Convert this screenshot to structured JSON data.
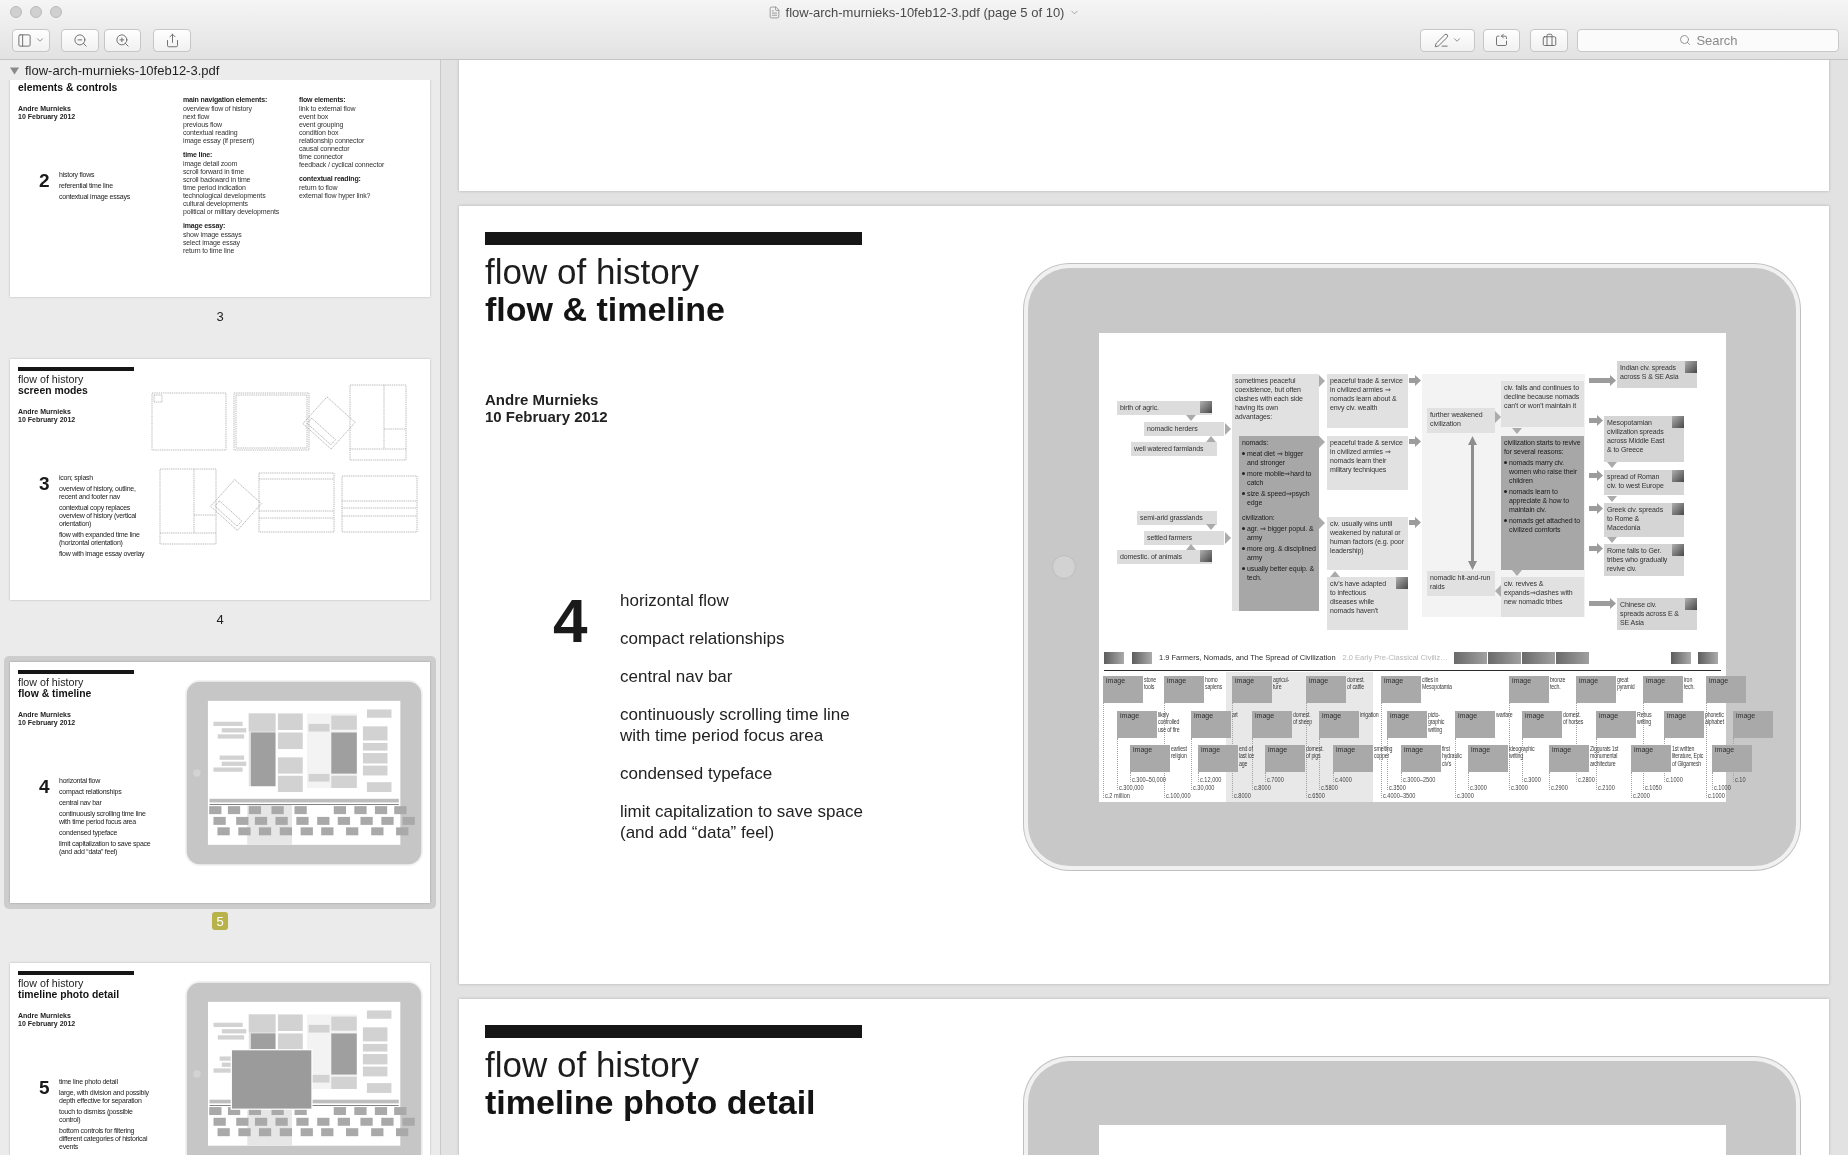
{
  "window": {
    "title": "flow-arch-murnieks-10feb12-3.pdf (page 5 of 10)"
  },
  "toolbar": {
    "search": {
      "placeholder": "Search"
    }
  },
  "sidebar": {
    "file": {
      "name": "flow-arch-murnieks-10feb12-3.pdf",
      "expanded": true
    },
    "thumbnails": [
      {
        "kind": "columns",
        "subtitle": "elements & controls",
        "author": "Andre Murnieks",
        "date": "10 February 2012",
        "number": "2",
        "points": [
          "history flows",
          "referential time line",
          "contextual image essays"
        ],
        "columns": [
          [
            {
              "heading": "main navigation elements:",
              "items": [
                "overview flow of history",
                "next flow",
                "previous flow",
                "contextual reading",
                "image essay (if present)"
              ]
            },
            {
              "heading": "time line:",
              "items": [
                "image detail zoom",
                "scroll forward in time",
                "scroll backward in time",
                "time period indication",
                "technological developments",
                "cultural developments",
                "political or military developments"
              ]
            },
            {
              "heading": "image essay:",
              "items": [
                "show image essays",
                "select image essay",
                "return to time line"
              ]
            }
          ],
          [
            {
              "heading": "flow elements:",
              "items": [
                "link to external flow",
                "event box",
                "event grouping",
                "condition box",
                "relationship connector",
                "causal connector",
                "time connector",
                "feedback / cyclical connector"
              ]
            },
            {
              "heading": "contextual reading:",
              "items": [
                "return to flow",
                "external flow hyper link?"
              ]
            }
          ]
        ],
        "page_label": "3",
        "selected": false
      },
      {
        "kind": "wireframes",
        "title": "flow of history",
        "subtitle": "screen modes",
        "author": "Andre Murnieks",
        "date": "10 February 2012",
        "number": "3",
        "points": [
          "icon; splash",
          "overview of history, outline,\nrecent and footer nav",
          "contextual copy replaces\noverview of history (vertical\norientation)",
          "flow with expanded time line\n(horizontal orientation)",
          "flow with image essay overlay"
        ],
        "page_label": "4",
        "selected": false
      },
      {
        "kind": "tablet",
        "title": "flow of history",
        "subtitle": "flow & timeline",
        "author": "Andre Murnieks",
        "date": "10 February 2012",
        "number": "4",
        "points": [
          "horizontal flow",
          "compact relationships",
          "central nav bar",
          "continuously scrolling time line\nwith time period focus area",
          "condensed typeface",
          "limit capitalization to save space\n(and add “data” feel)"
        ],
        "page_label": "5",
        "selected": true
      },
      {
        "kind": "tablet-photo",
        "title": "flow of history",
        "subtitle": "timeline photo detail",
        "author": "Andre Murnieks",
        "date": "10 February 2012",
        "number": "5",
        "points": [
          "time line photo detail",
          "large, with division and possibly\ndepth effective for separation",
          "touch to dismiss (possible\ncontrol)",
          "bottom controls for filtering\ndifferent categories of historical\nevents"
        ],
        "selected": false
      }
    ]
  },
  "pages": [
    {
      "kind": "blank"
    },
    {
      "kind": "slide",
      "title": "flow of history",
      "subtitle": "flow & timeline",
      "author": "Andre Murnieks",
      "date": "10 February 2012",
      "number": "4",
      "points": [
        "horizontal flow",
        "compact relationships",
        "central nav bar",
        "continuously scrolling time line\nwith time period focus area",
        "condensed typeface",
        "limit capitalization to save space\n(and add “data” feel)"
      ],
      "tablet": {
        "flow": {
          "nodes": [
            {
              "kind": "condition",
              "text": "birth of agric.",
              "thumbnail": true
            },
            {
              "kind": "condition",
              "text": "nomadic herders",
              "thumbnail": false
            },
            {
              "kind": "condition",
              "text": "well watered farmlands",
              "thumbnail": false
            },
            {
              "kind": "condition",
              "text": "semi-arid grasslands",
              "thumbnail": false
            },
            {
              "kind": "condition",
              "text": "settled farmers",
              "thumbnail": false
            },
            {
              "kind": "condition",
              "text": "domestic. of animals",
              "thumbnail": true
            },
            {
              "kind": "note",
              "text": "sometimes peaceful coexistence, but often clashes with each side having its own advantages:",
              "thumbnail": false
            },
            {
              "kind": "shaded",
              "items": [
                {
                  "kind": "heading",
                  "text": "nomads:"
                },
                {
                  "kind": "bullet",
                  "text": "meat diet ⇒ bigger and stronger"
                },
                {
                  "kind": "bullet",
                  "text": "more mobile⇒hard to catch"
                },
                {
                  "kind": "bullet",
                  "text": "size & speed⇒psych edge"
                },
                {
                  "kind": "heading",
                  "text": "civilization:"
                },
                {
                  "kind": "bullet",
                  "text": "agr. ⇒ bigger popul. & army"
                },
                {
                  "kind": "bullet",
                  "text": "more org. & disciplined army"
                },
                {
                  "kind": "bullet",
                  "text": "usually better equip. & tech."
                }
              ],
              "thumbnail": false
            },
            {
              "kind": "note",
              "text": "peaceful trade & service in civilized armies ⇒ nomads learn about & envy civ. wealth",
              "thumbnail": false
            },
            {
              "kind": "note",
              "text": "peaceful trade & service in civilized armies ⇒ nomads learn their military techniques",
              "thumbnail": false
            },
            {
              "kind": "note",
              "text": "civ. usually wins until weakened by natural or human factors (e.g. poor leadership)",
              "thumbnail": false
            },
            {
              "kind": "note",
              "text": "civ's have adapted to infectious diseases while nomads haven't",
              "thumbnail": true
            },
            {
              "kind": "note",
              "text": "further weakened civilization",
              "thumbnail": false
            },
            {
              "kind": "note",
              "text": "nomadic hit-and-run raids",
              "thumbnail": false
            },
            {
              "kind": "note",
              "text": "civ. falls and continues to decline because nomads can't or won't maintain it",
              "thumbnail": false
            },
            {
              "kind": "shaded",
              "items": [
                {
                  "kind": "heading",
                  "text": "civilization starts to revive for several reasons:"
                },
                {
                  "kind": "bullet",
                  "text": "nomads marry civ. women who raise their children"
                },
                {
                  "kind": "bullet",
                  "text": "nomads learn to appreciate & how to maintain civ."
                },
                {
                  "kind": "bullet",
                  "text": "nomads get attached to civilized comforts"
                }
              ],
              "thumbnail": false
            },
            {
              "kind": "note",
              "text": "civ. revives & expands⇒clashes with new nomadic tribes",
              "thumbnail": false
            },
            {
              "kind": "outcome",
              "text": "Indian civ. spreads across S & SE Asia",
              "thumbnail": true
            },
            {
              "kind": "outcome",
              "text": "Mesopotamian civilization spreads across Middle East & to Greece",
              "thumbnail": true
            },
            {
              "kind": "outcome",
              "text": "spread of Roman civ. to west Europe",
              "thumbnail": true
            },
            {
              "kind": "outcome",
              "text": "Greek civ. spreads to Rome & Macedonia",
              "thumbnail": true
            },
            {
              "kind": "outcome",
              "text": "Rome falls to Ger. tribes who gradually revive civ.",
              "thumbnail": true
            },
            {
              "kind": "outcome",
              "text": "Chinese civ. spreads across E & SE Asia",
              "thumbnail": true
            }
          ]
        },
        "nav": {
          "current": "1.9 Farmers, Nomads, and The Spread of Civilization",
          "next": "2.0 Early Pre-Classical Civiliz…"
        },
        "timeline": {
          "rows": [
            [
              {
                "tag": "image",
                "label": "stone\ntools",
                "date": "c.2 million"
              },
              {
                "tag": "image",
                "label": "homo\nsapiens",
                "date": "c.100,000"
              },
              {
                "tag": "image",
                "label": "agricul-\nture",
                "date": "c.8000"
              },
              {
                "tag": "image",
                "label": "domest.\nof cattle",
                "date": "c.6500"
              },
              {
                "tag": "image",
                "label": "cities in\nMesopotamia",
                "date": "c.4000–3500"
              },
              {
                "tag": "image",
                "label": "bronze\ntech.",
                "date": "c.3000"
              },
              {
                "tag": "image",
                "label": "great\npyramid",
                "date": "c.2800"
              },
              {
                "tag": "image",
                "label": "iron\ntech.",
                "date": "c.1050"
              },
              {
                "tag": "image",
                "date": "c.1000"
              }
            ],
            [
              {
                "tag": "image",
                "label": "likely\ncontrolled\nuse of fire",
                "date": "c.300,000"
              },
              {
                "tag": "image",
                "label": "art",
                "date": "c.30,000"
              },
              {
                "tag": "image",
                "label": "domest.\nof sheep",
                "date": "c.8000"
              },
              {
                "tag": "image",
                "label": "irrigation",
                "date": "c.5800"
              },
              {
                "tag": "image",
                "label": "picto-\ngraphic\nwriting",
                "date": "c.3500"
              },
              {
                "tag": "image",
                "label": "warfare",
                "date": "c.3000"
              },
              {
                "tag": "image",
                "label": "domest.\nof horses",
                "date": "c.3000"
              },
              {
                "tag": "image",
                "label": "Rebus\nwriting",
                "date": "c.2100"
              },
              {
                "tag": "image",
                "label": "phonetic\nalphabet",
                "date": "c.1000"
              },
              {
                "tag": "image",
                "date": "c.10"
              }
            ],
            [
              {
                "tag": "image",
                "label": "earliest\nreligion",
                "date": "c.300–50,000"
              },
              {
                "tag": "image",
                "label": "end of\nlast ice\nage",
                "date": "c.12,000"
              },
              {
                "tag": "image",
                "label": "domest.\nof pigs",
                "date": "c.7000"
              },
              {
                "tag": "image",
                "label": "smelting\ncopper",
                "date": "c.4000"
              },
              {
                "tag": "image",
                "label": "first\nhydraulic\nciv's",
                "date": "c.3000–2500"
              },
              {
                "tag": "image",
                "label": "ideographic\nwriting",
                "date": "c.3000"
              },
              {
                "tag": "image",
                "label": "Ziggurats 1st\nmonumental\narchitecture",
                "date": "c.2900"
              },
              {
                "tag": "image",
                "label": "1st written\nliterature, Epic\nof Gilgamesh",
                "date": "c.2000"
              },
              {
                "tag": "image",
                "date": "c.1000"
              }
            ]
          ]
        }
      }
    },
    {
      "kind": "slide-top",
      "title": "flow of history",
      "subtitle": "timeline photo detail"
    }
  ]
}
